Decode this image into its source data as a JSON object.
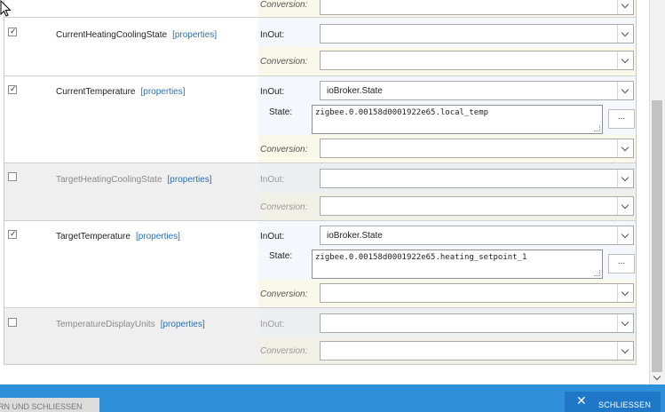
{
  "characteristics": [
    {
      "name": "",
      "checked": true,
      "enabled": true,
      "conversion_label": "Conversion:",
      "conversion_value": ""
    },
    {
      "name": "CurrentHeatingCoolingState",
      "props_label": "[properties]",
      "checked": true,
      "enabled": true,
      "inout_label": "InOut:",
      "inout_value": "",
      "conversion_label": "Conversion:",
      "conversion_value": ""
    },
    {
      "name": "CurrentTemperature",
      "props_label": "[properties]",
      "checked": true,
      "enabled": true,
      "inout_label": "InOut:",
      "inout_value": "ioBroker.State",
      "state_label": "State:",
      "state_value": "zigbee.0.00158d0001922e65.local_temp",
      "browse_label": "...",
      "conversion_label": "Conversion:",
      "conversion_value": ""
    },
    {
      "name": "TargetHeatingCoolingState",
      "props_label": "[properties]",
      "checked": false,
      "enabled": false,
      "inout_label": "InOut:",
      "inout_value": "",
      "conversion_label": "Conversion:",
      "conversion_value": ""
    },
    {
      "name": "TargetTemperature",
      "props_label": "[properties]",
      "checked": true,
      "enabled": true,
      "inout_label": "InOut:",
      "inout_value": "ioBroker.State",
      "state_label": "State:",
      "state_value": "zigbee.0.00158d0001922e65.heating_setpoint_1",
      "browse_label": "...",
      "conversion_label": "Conversion:",
      "conversion_value": ""
    },
    {
      "name": "TemperatureDisplayUnits",
      "props_label": "[properties]",
      "checked": false,
      "enabled": false,
      "inout_label": "InOut:",
      "inout_value": "",
      "conversion_label": "Conversion:",
      "conversion_value": ""
    }
  ],
  "footer": {
    "save_close_label": "ERN UND SCHLIESSEN",
    "close_label": "SCHLIESSEN",
    "close_icon": "close-icon",
    "background_color": "#2f8fd8"
  },
  "colors": {
    "link": "#2a6fb8",
    "disabled_row": "#efefef",
    "inout_area": "#f4f8fc",
    "conversion_area": "#faf8e9"
  }
}
